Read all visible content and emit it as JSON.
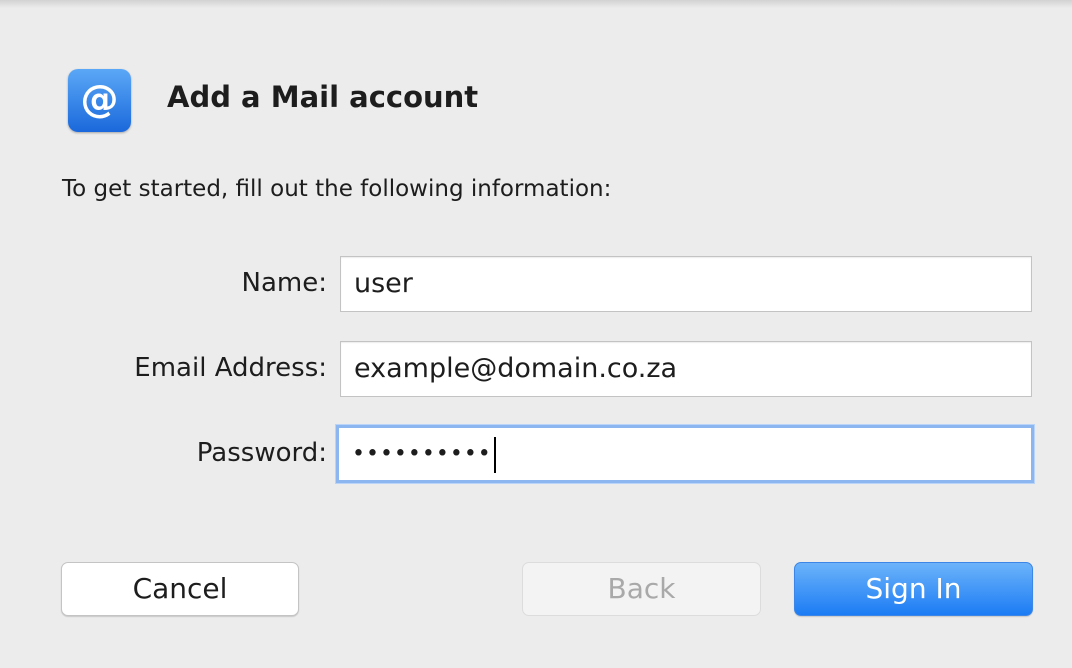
{
  "dialog": {
    "title": "Add a Mail account",
    "icon": "at-sign-icon",
    "icon_glyph": "@",
    "intro": "To get started, fill out the following information:"
  },
  "form": {
    "name_label": "Name:",
    "name_value": "user",
    "email_label": "Email Address:",
    "email_value": "example@domain.co.za",
    "password_label": "Password:",
    "password_value": "••••••••••"
  },
  "buttons": {
    "cancel": "Cancel",
    "back": "Back",
    "sign_in": "Sign In"
  },
  "colors": {
    "accent": "#1c7cf4",
    "focus_ring": "#8cb6f0",
    "background": "#ececec"
  }
}
